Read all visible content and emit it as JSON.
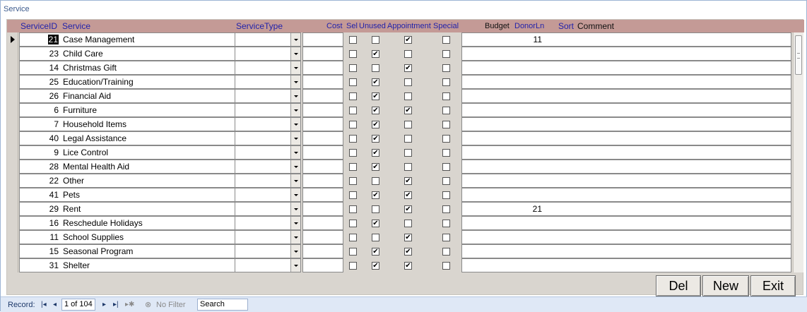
{
  "window": {
    "title": "Service"
  },
  "columns": {
    "service_id": "ServiceID",
    "service": "Service",
    "service_type": "ServiceType",
    "cost": "Cost",
    "sel": "Sel",
    "unused": "Unused",
    "appointment": "Appointment",
    "special": "Special",
    "budget": "Budget",
    "donor_ln": "DonorLn",
    "sort": "Sort",
    "comment": "Comment"
  },
  "rows": [
    {
      "id": "21",
      "service": "Case Management",
      "sel": false,
      "unused": false,
      "appointment": true,
      "special": false,
      "donor_ln": "11",
      "selected": true
    },
    {
      "id": "23",
      "service": "Child Care",
      "sel": false,
      "unused": true,
      "appointment": false,
      "special": false,
      "donor_ln": ""
    },
    {
      "id": "14",
      "service": "Christmas Gift",
      "sel": false,
      "unused": false,
      "appointment": true,
      "special": false,
      "donor_ln": ""
    },
    {
      "id": "25",
      "service": "Education/Training",
      "sel": false,
      "unused": true,
      "appointment": false,
      "special": false,
      "donor_ln": ""
    },
    {
      "id": "26",
      "service": "Financial Aid",
      "sel": false,
      "unused": true,
      "appointment": false,
      "special": false,
      "donor_ln": ""
    },
    {
      "id": "6",
      "service": "Furniture",
      "sel": false,
      "unused": true,
      "appointment": true,
      "special": false,
      "donor_ln": ""
    },
    {
      "id": "7",
      "service": "Household Items",
      "sel": false,
      "unused": true,
      "appointment": false,
      "special": false,
      "donor_ln": ""
    },
    {
      "id": "40",
      "service": "Legal Assistance",
      "sel": false,
      "unused": true,
      "appointment": false,
      "special": false,
      "donor_ln": ""
    },
    {
      "id": "9",
      "service": "Lice Control",
      "sel": false,
      "unused": true,
      "appointment": false,
      "special": false,
      "donor_ln": ""
    },
    {
      "id": "28",
      "service": "Mental Health Aid",
      "sel": false,
      "unused": true,
      "appointment": false,
      "special": false,
      "donor_ln": ""
    },
    {
      "id": "22",
      "service": "Other",
      "sel": false,
      "unused": false,
      "appointment": true,
      "special": false,
      "donor_ln": ""
    },
    {
      "id": "41",
      "service": "Pets",
      "sel": false,
      "unused": true,
      "appointment": true,
      "special": false,
      "donor_ln": ""
    },
    {
      "id": "29",
      "service": "Rent",
      "sel": false,
      "unused": false,
      "appointment": true,
      "special": false,
      "donor_ln": "21"
    },
    {
      "id": "16",
      "service": "Reschedule Holidays",
      "sel": false,
      "unused": true,
      "appointment": false,
      "special": false,
      "donor_ln": ""
    },
    {
      "id": "11",
      "service": "School Supplies",
      "sel": false,
      "unused": false,
      "appointment": true,
      "special": false,
      "donor_ln": ""
    },
    {
      "id": "15",
      "service": "Seasonal Program",
      "sel": false,
      "unused": true,
      "appointment": true,
      "special": false,
      "donor_ln": ""
    },
    {
      "id": "31",
      "service": "Shelter",
      "sel": false,
      "unused": true,
      "appointment": true,
      "special": false,
      "donor_ln": ""
    }
  ],
  "buttons": {
    "del": "Del",
    "new": "New",
    "exit": "Exit"
  },
  "statusbar": {
    "record_label": "Record:",
    "record_value": "1 of 104",
    "filter_label": "No Filter",
    "search_label": "Search"
  },
  "colors": {
    "header_bg": "#c49a96",
    "header_text": "#2222aa",
    "form_bg": "#d9d5cf",
    "status_bg": "#dfe8f6"
  }
}
